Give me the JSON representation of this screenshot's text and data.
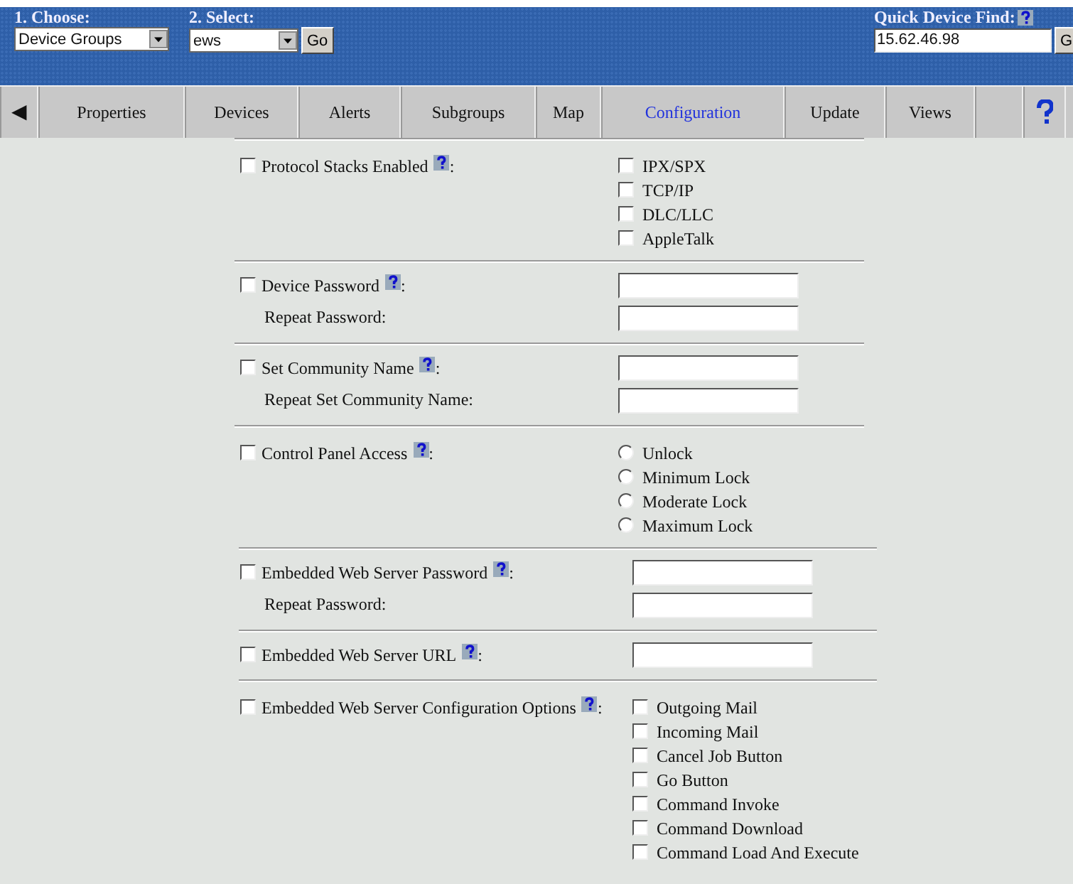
{
  "header": {
    "choose": {
      "label": "1. Choose:",
      "value": "Device Groups"
    },
    "select": {
      "label": "2. Select:",
      "value": "ews",
      "button": "Go"
    },
    "quick_find": {
      "label": "Quick Device Find:",
      "value": "15.62.46.98",
      "button": "G"
    }
  },
  "tabs": [
    {
      "kind": "arrow",
      "label": "◀",
      "selected": false
    },
    {
      "kind": "text",
      "label": "Properties",
      "selected": false
    },
    {
      "kind": "text",
      "label": "Devices",
      "selected": false
    },
    {
      "kind": "text",
      "label": "Alerts",
      "selected": false
    },
    {
      "kind": "text",
      "label": "Subgroups",
      "selected": false
    },
    {
      "kind": "text",
      "label": "Map",
      "selected": false
    },
    {
      "kind": "text",
      "label": "Configuration",
      "selected": true
    },
    {
      "kind": "text",
      "label": "Update",
      "selected": false
    },
    {
      "kind": "text",
      "label": "Views",
      "selected": false
    },
    {
      "kind": "blank"
    },
    {
      "kind": "help",
      "selected": false
    }
  ],
  "sections": [
    {
      "kind": "checklist",
      "checked": false,
      "label": "Protocol Stacks Enabled",
      "suffix": ":",
      "options": [
        {
          "label": "IPX/SPX",
          "checked": false
        },
        {
          "label": "TCP/IP",
          "checked": false
        },
        {
          "label": "DLC/LLC",
          "checked": false
        },
        {
          "label": "AppleTalk",
          "checked": false
        }
      ]
    },
    {
      "kind": "fields",
      "checked": false,
      "label": "Device Password",
      "suffix": ":",
      "rows": [
        {},
        {
          "label": "Repeat Password:"
        }
      ]
    },
    {
      "kind": "fields",
      "checked": false,
      "label": "Set Community Name",
      "suffix": ":",
      "rows": [
        {},
        {
          "label": "Repeat Set Community Name:"
        }
      ]
    },
    {
      "kind": "radio",
      "checked": false,
      "label": "Control Panel Access",
      "suffix": ":",
      "options": [
        {
          "label": "Unlock",
          "selected": false
        },
        {
          "label": "Minimum Lock",
          "selected": false
        },
        {
          "label": "Moderate Lock",
          "selected": false
        },
        {
          "label": "Maximum Lock",
          "selected": false
        }
      ]
    },
    {
      "kind": "fields",
      "checked": false,
      "label": "Embedded Web Server Password",
      "suffix": ":",
      "rows": [
        {},
        {
          "label": "Repeat Password:"
        }
      ]
    },
    {
      "kind": "fields",
      "checked": false,
      "label": "Embedded Web Server URL",
      "suffix": ":",
      "rows": [
        {}
      ]
    },
    {
      "kind": "checklist",
      "checked": false,
      "label": "Embedded Web Server Configuration Options",
      "suffix": ":",
      "options": [
        {
          "label": "Outgoing Mail",
          "checked": false
        },
        {
          "label": "Incoming Mail",
          "checked": false
        },
        {
          "label": "Cancel Job Button",
          "checked": false
        },
        {
          "label": "Go Button",
          "checked": false
        },
        {
          "label": "Command Invoke",
          "checked": false
        },
        {
          "label": "Command Download",
          "checked": false
        },
        {
          "label": "Command Load And Execute",
          "checked": false
        }
      ]
    }
  ]
}
